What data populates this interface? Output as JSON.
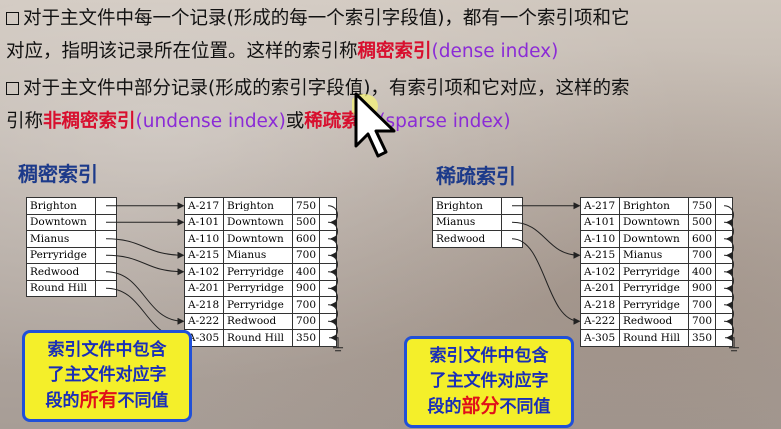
{
  "para1": {
    "text_a": "对于主文件中每一个记录(形成的每一个索引字段值)，都有一个索引项和它",
    "text_b": "对应，指明该记录所在位置。这样的索引称",
    "term": "稠密索引",
    "english": "(dense index)"
  },
  "para2": {
    "text_a": "对于主文件中部分记录(形成的索引字段值)，有索引项和它对应，这样的索",
    "text_b": "引称",
    "term1": "非稠密索引",
    "english1": "(undense index)",
    "or": "或",
    "term2": "稀疏索引",
    "english2": "(sparse index)"
  },
  "dense_title": "稠密索引",
  "sparse_title": "稀疏索引",
  "dense_index": [
    "Brighton",
    "Downtown",
    "Mianus",
    "Perryridge",
    "Redwood",
    "Round Hill"
  ],
  "sparse_index": [
    "Brighton",
    "Mianus",
    "Redwood"
  ],
  "main_file": [
    [
      "A-217",
      "Brighton",
      "750"
    ],
    [
      "A-101",
      "Downtown",
      "500"
    ],
    [
      "A-110",
      "Downtown",
      "600"
    ],
    [
      "A-215",
      "Mianus",
      "700"
    ],
    [
      "A-102",
      "Perryridge",
      "400"
    ],
    [
      "A-201",
      "Perryridge",
      "900"
    ],
    [
      "A-218",
      "Perryridge",
      "700"
    ],
    [
      "A-222",
      "Redwood",
      "700"
    ],
    [
      "A-305",
      "Round Hill",
      "350"
    ]
  ],
  "callout_dense": {
    "line1": "索引文件中包含",
    "line2": "了主文件对应字",
    "line3_a": "段的",
    "line3_hl": "所有",
    "line3_b": "不同值"
  },
  "callout_sparse": {
    "line1": "索引文件中包含",
    "line2": "了主文件对应字",
    "line3_a": "段的",
    "line3_hl": "部分",
    "line3_b": "不同值"
  },
  "colors": {
    "term_red": "#d80f2e",
    "english_purple": "#8b2bd6",
    "title_blue": "#1c3a8a",
    "callout_yellow": "#f4ef2a",
    "callout_border": "#2050d8"
  },
  "icons": {
    "cursor": "arrow-cursor-icon",
    "bullet": "checkbox-bullet-icon"
  }
}
